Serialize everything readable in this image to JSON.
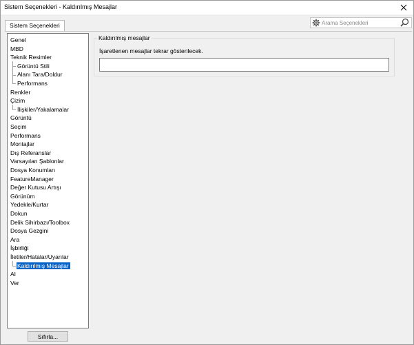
{
  "window": {
    "title": "Sistem Seçenekleri - Kaldırılmış Mesajlar",
    "close_icon": "close-icon"
  },
  "tabs": [
    {
      "label": "Sistem Seçenekleri",
      "active": true
    }
  ],
  "search": {
    "placeholder": "Arama Seçenekleri",
    "value": "",
    "gear_icon": "gear-icon",
    "search_icon": "search-icon"
  },
  "tree": {
    "items": [
      {
        "label": "Genel",
        "level": 0
      },
      {
        "label": "MBD",
        "level": 0
      },
      {
        "label": "Teknik Resimler",
        "level": 0
      },
      {
        "label": "Görüntü Stili",
        "level": 1
      },
      {
        "label": "Alanı Tara/Doldur",
        "level": 1
      },
      {
        "label": "Performans",
        "level": 1
      },
      {
        "label": "Renkler",
        "level": 0
      },
      {
        "label": "Çizim",
        "level": 0
      },
      {
        "label": "İlişkiler/Yakalamalar",
        "level": 1
      },
      {
        "label": "Görüntü",
        "level": 0
      },
      {
        "label": "Seçim",
        "level": 0
      },
      {
        "label": "Performans",
        "level": 0
      },
      {
        "label": "Montajlar",
        "level": 0
      },
      {
        "label": "Dış Referanslar",
        "level": 0
      },
      {
        "label": "Varsayılan Şablonlar",
        "level": 0
      },
      {
        "label": "Dosya Konumları",
        "level": 0
      },
      {
        "label": "FeatureManager",
        "level": 0
      },
      {
        "label": "Değer Kutusu Artışı",
        "level": 0
      },
      {
        "label": "Görünüm",
        "level": 0
      },
      {
        "label": "Yedekle/Kurtar",
        "level": 0
      },
      {
        "label": "Dokun",
        "level": 0
      },
      {
        "label": "Delik Sihirbazı/Toolbox",
        "level": 0
      },
      {
        "label": "Dosya Gezgini",
        "level": 0
      },
      {
        "label": "Ara",
        "level": 0
      },
      {
        "label": "İşbirliği",
        "level": 0
      },
      {
        "label": "İletiler/Hatalar/Uyarılar",
        "level": 0
      },
      {
        "label": "Kaldırılmış Mesajlar",
        "level": 1,
        "selected": true
      },
      {
        "label": "AI",
        "level": 0
      },
      {
        "label": "Ver",
        "level": 0
      }
    ]
  },
  "reset_button": {
    "label": "Sıfırla..."
  },
  "dismissed_messages": {
    "group_title": "Kaldırılmış mesajlar",
    "description": "İşaretlenen mesajlar tekrar gösterilecek.",
    "items": []
  },
  "colors": {
    "selection": "#0a64c8",
    "window_bg": "#f0f0f0"
  }
}
